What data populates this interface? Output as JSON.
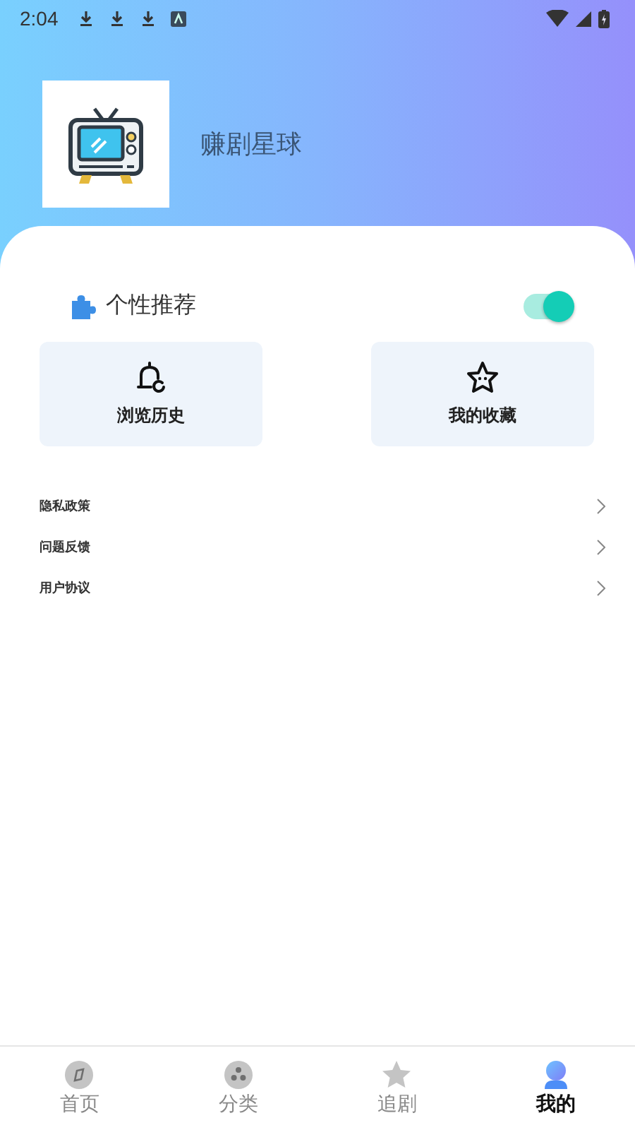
{
  "status_bar": {
    "time": "2:04"
  },
  "profile": {
    "app_name": "赚剧星球"
  },
  "personalized": {
    "label": "个性推荐",
    "on": true
  },
  "shortcuts": [
    {
      "label": "浏览历史"
    },
    {
      "label": "我的收藏"
    }
  ],
  "menu": [
    {
      "label": "隐私政策"
    },
    {
      "label": "问题反馈"
    },
    {
      "label": "用户协议"
    }
  ],
  "tabs": [
    {
      "label": "首页",
      "selected": false
    },
    {
      "label": "分类",
      "selected": false
    },
    {
      "label": "追剧",
      "selected": false
    },
    {
      "label": "我的",
      "selected": true
    }
  ]
}
